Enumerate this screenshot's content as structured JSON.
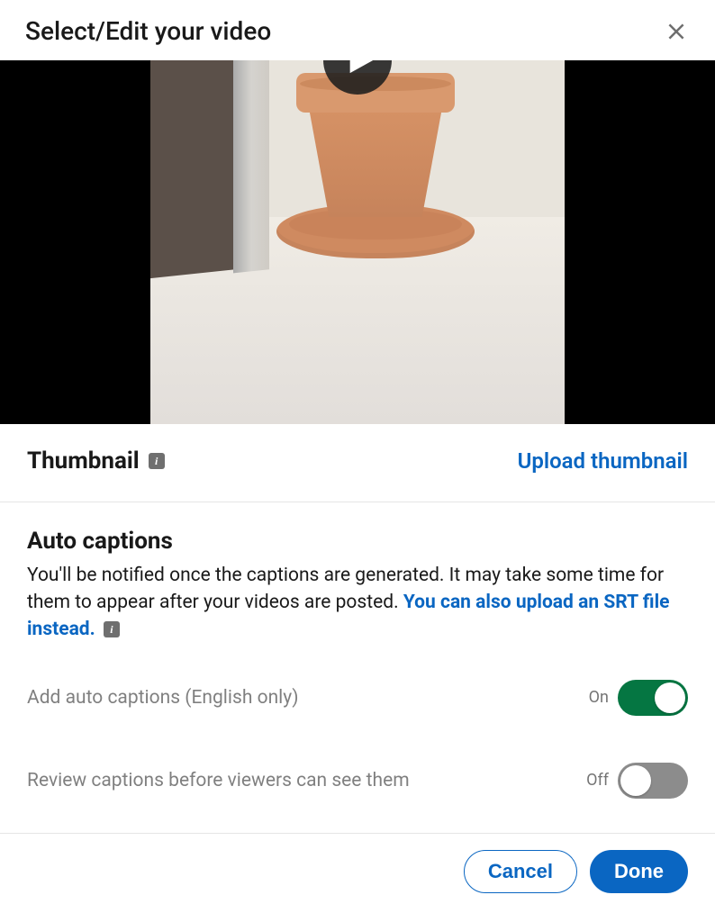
{
  "header": {
    "title": "Select/Edit your video"
  },
  "thumbnail": {
    "label": "Thumbnail",
    "upload_label": "Upload thumbnail"
  },
  "captions": {
    "title": "Auto captions",
    "desc_part1": "You'll be notified once the captions are generated. It may take some time for them to appear after your videos are posted. ",
    "srt_link": "You can also upload an SRT file instead.",
    "toggles": {
      "add": {
        "label": "Add auto captions (English only)",
        "state": "On",
        "on": true
      },
      "review": {
        "label": "Review captions before viewers can see them",
        "state": "Off",
        "on": false
      }
    }
  },
  "footer": {
    "cancel": "Cancel",
    "done": "Done"
  },
  "info_glyph": "i"
}
